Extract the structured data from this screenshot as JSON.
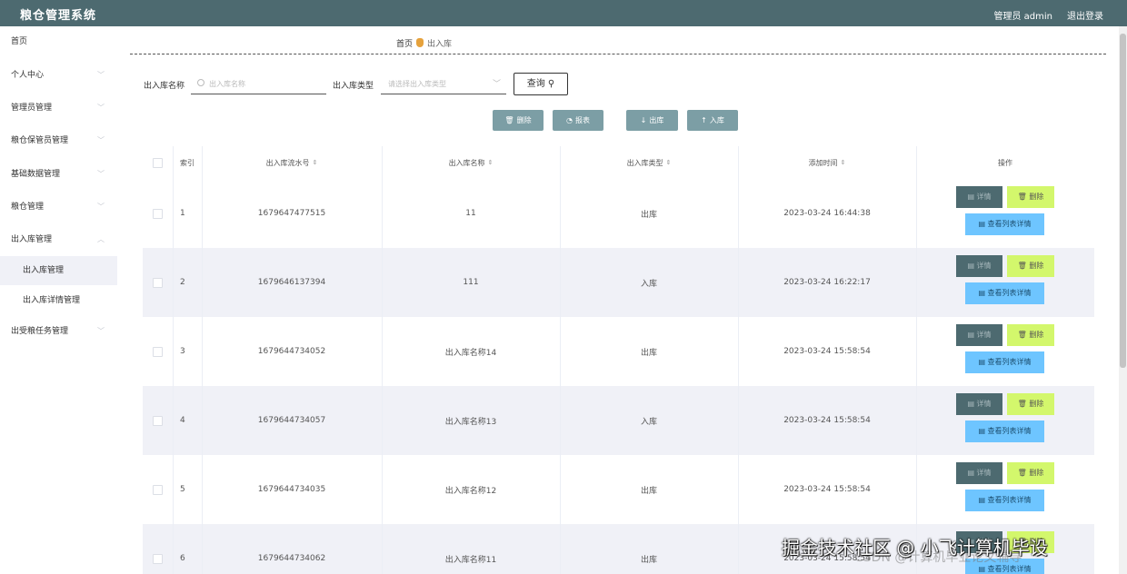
{
  "app": {
    "title": "粮仓管理系统",
    "user_label": "管理员 admin",
    "logout_label": "退出登录"
  },
  "sidebar": {
    "items": [
      {
        "label": "首页"
      },
      {
        "label": "个人中心"
      },
      {
        "label": "管理员管理"
      },
      {
        "label": "粮仓保管员管理"
      },
      {
        "label": "基础数据管理"
      },
      {
        "label": "粮仓管理"
      },
      {
        "label": "出入库管理"
      },
      {
        "label": "出受粮任务管理"
      }
    ],
    "subitems": [
      {
        "label": "出入库管理",
        "active": true
      },
      {
        "label": "出入库详情管理",
        "active": false
      }
    ]
  },
  "breadcrumb": {
    "home": "首页",
    "current": "出入库"
  },
  "search": {
    "name_label": "出入库名称",
    "name_placeholder": "出入库名称",
    "type_label": "出入库类型",
    "type_placeholder": "请选择出入库类型",
    "query_label": "查询"
  },
  "actions": {
    "delete": "删除",
    "report": "报表",
    "out": "出库",
    "in": "入库"
  },
  "table": {
    "headers": [
      "索引",
      "出入库流水号",
      "出入库名称",
      "出入库类型",
      "添加时间",
      "操作"
    ],
    "rows": [
      {
        "index": "1",
        "serial": "1679647477515",
        "name": "11",
        "type": "出库",
        "time": "2023-03-24 16:44:38"
      },
      {
        "index": "2",
        "serial": "1679646137394",
        "name": "111",
        "type": "入库",
        "time": "2023-03-24 16:22:17"
      },
      {
        "index": "3",
        "serial": "1679644734052",
        "name": "出入库名称14",
        "type": "出库",
        "time": "2023-03-24 15:58:54"
      },
      {
        "index": "4",
        "serial": "1679644734057",
        "name": "出入库名称13",
        "type": "入库",
        "time": "2023-03-24 15:58:54"
      },
      {
        "index": "5",
        "serial": "1679644734035",
        "name": "出入库名称12",
        "type": "出库",
        "time": "2023-03-24 15:58:54"
      },
      {
        "index": "6",
        "serial": "1679644734062",
        "name": "出入库名称11",
        "type": "出库",
        "time": "2023-03-24 15:58:54"
      }
    ],
    "row_actions": {
      "detail": "详情",
      "delete": "删除",
      "list_detail": "查看列表详情"
    }
  },
  "watermark": {
    "text": "掘金技术社区 @ 小飞计算机毕设",
    "overlay": "CSDN @计算机毕业论文辅导"
  },
  "colors": {
    "topbar": "#4d6a70",
    "action": "#7c9ea5",
    "delete": "#d3f76c",
    "list": "#6ec5ff"
  }
}
